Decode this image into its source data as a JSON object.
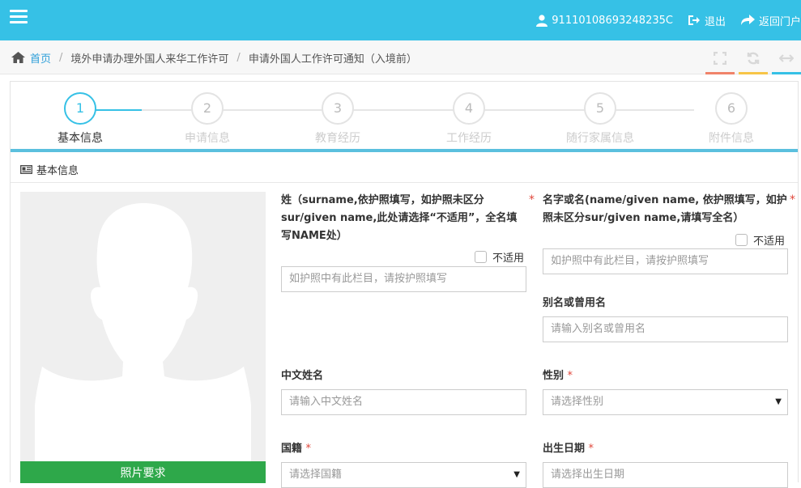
{
  "header": {
    "user_id": "91110108693248235C",
    "logout_label": "退出",
    "portal_label": "返回门户"
  },
  "breadcrumb": {
    "home": "首页",
    "level1": "境外申请办理外国人来华工作许可",
    "level2": "申请外国人工作许可通知（入境前）"
  },
  "tools": [
    {
      "icon": "fullscreen-icon",
      "color": "#f0836a"
    },
    {
      "icon": "refresh-icon",
      "color": "#f7c547"
    },
    {
      "icon": "arrows-horizontal-icon",
      "color": "#36c1e6"
    }
  ],
  "steps": [
    {
      "num": "1",
      "label": "基本信息"
    },
    {
      "num": "2",
      "label": "申请信息"
    },
    {
      "num": "3",
      "label": "教育经历"
    },
    {
      "num": "4",
      "label": "工作经历"
    },
    {
      "num": "5",
      "label": "随行家属信息"
    },
    {
      "num": "6",
      "label": "附件信息"
    }
  ],
  "active_step": 1,
  "section_title": "基本信息",
  "photo_button": "照片要求",
  "form": {
    "surname": {
      "label": "姓（surname,依护照填写，如护照未区分sur/given name,此处请选择“不适用”，全名填写NAME处）",
      "na_label": "不适用",
      "placeholder": "如护照中有此栏目，请按护照填写"
    },
    "given_name": {
      "label": "名字或名(name/given name, 依护照填写，如护照未区分sur/given name,请填写全名）",
      "na_label": "不适用",
      "placeholder": "如护照中有此栏目，请按护照填写"
    },
    "alias": {
      "label": "别名或曾用名",
      "placeholder": "请输入别名或曾用名"
    },
    "chinese_name": {
      "label": "中文姓名",
      "placeholder": "请输入中文姓名"
    },
    "gender": {
      "label": "性别",
      "placeholder": "请选择性别"
    },
    "nationality": {
      "label": "国籍",
      "placeholder": "请选择国籍"
    },
    "birth_date": {
      "label": "出生日期",
      "placeholder": "请选择出生日期"
    },
    "required_mark": "*"
  },
  "colors": {
    "header_bg": "#36c1e6",
    "active_step": "#36c1e6",
    "photo_button": "#2ea84a",
    "required": "#e0463a"
  }
}
